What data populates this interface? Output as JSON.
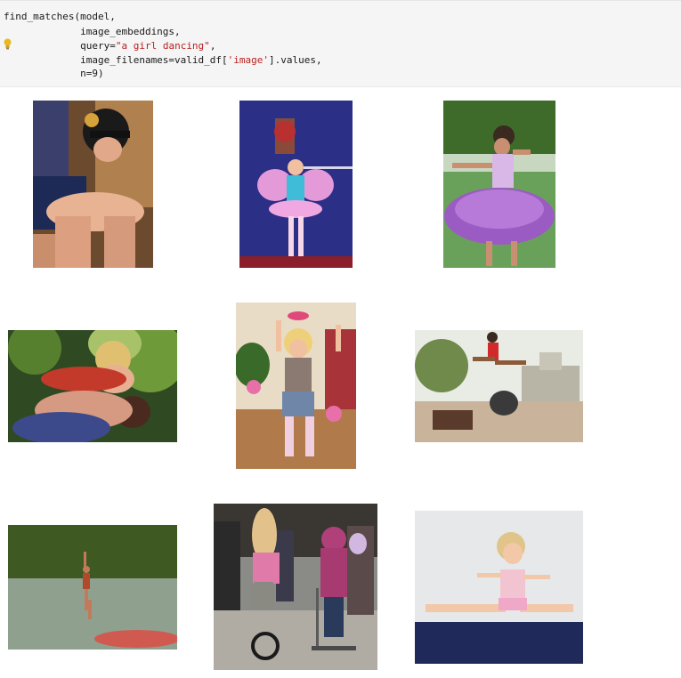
{
  "code": {
    "line1": "find_matches(model,",
    "line2": "             image_embeddings,",
    "line3_prefix": "             query=",
    "line3_str": "\"a girl dancing\"",
    "line3_suffix": ",",
    "line4_prefix": "             image_filenames=valid_df[",
    "line4_str": "'image'",
    "line4_suffix": "].values,",
    "line5": "             n=9)",
    "bulb_icon": "lightbulb-icon"
  },
  "results": [
    {
      "subject": "swimmer in cap and goggles"
    },
    {
      "subject": "girl in fairy costume on stage"
    },
    {
      "subject": "girl in purple tutu dancing on grass"
    },
    {
      "subject": "man embracing person"
    },
    {
      "subject": "girl dancing with balloons"
    },
    {
      "subject": "child jumping near fountain"
    },
    {
      "subject": "girl jumping into lake"
    },
    {
      "subject": "children on unicycle and scooter"
    },
    {
      "subject": "girl jumping onto mat"
    }
  ]
}
